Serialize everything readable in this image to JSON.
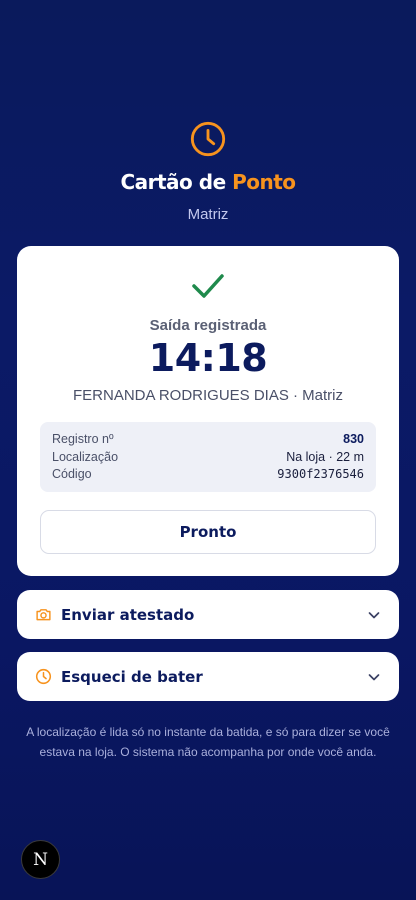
{
  "header": {
    "brand_part1": "Cartão de ",
    "brand_part2": "Ponto",
    "subtitle": "Matriz"
  },
  "confirmation": {
    "status": "Saída registrada",
    "time": "14:18",
    "employee_line": "FERNANDA RODRIGUES DIAS · Matriz",
    "details": [
      {
        "label": "Registro nº",
        "value": "830"
      },
      {
        "label": "Localização",
        "value": "Na loja · 22 m"
      },
      {
        "label": "Código",
        "value": "9300f2376546"
      }
    ],
    "done_label": "Pronto"
  },
  "accordions": [
    {
      "label": "Enviar atestado",
      "icon": "camera-icon"
    },
    {
      "label": "Esqueci de bater",
      "icon": "clock-icon"
    }
  ],
  "footnote": "A localização é lida só no instante da batida, e só para dizer se você estava na loja. O sistema não acompanha por onde você anda.",
  "badge": {
    "letter": "N"
  },
  "colors": {
    "accent": "#f7931e",
    "primary": "#0c1b5e",
    "success": "#1f8a4c",
    "background": "#0b1a66"
  }
}
